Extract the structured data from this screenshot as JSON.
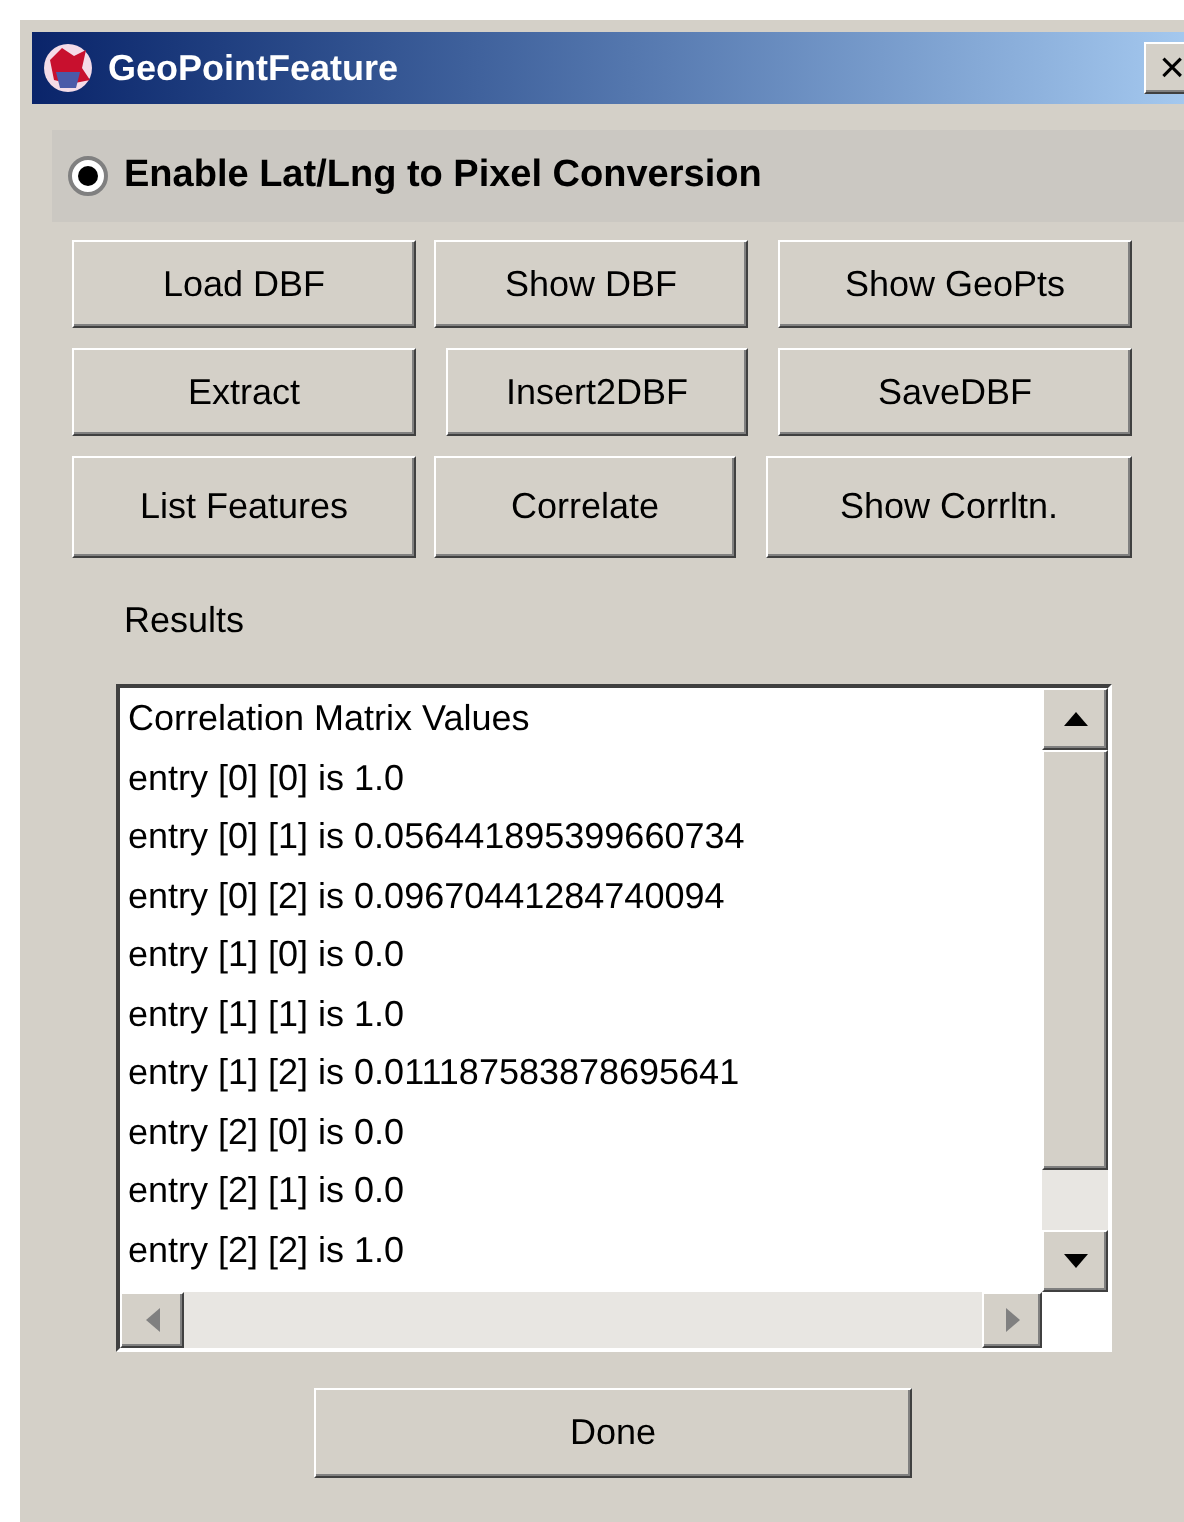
{
  "window": {
    "title": "GeoPointFeature",
    "close": "×"
  },
  "option": {
    "label": "Enable Lat/Lng to Pixel Conversion",
    "selected": true
  },
  "button_rows": [
    [
      "Load DBF",
      "Show DBF",
      "Show GeoPts"
    ],
    [
      "Extract",
      "Insert2DBF",
      "SaveDBF"
    ],
    [
      "List Features",
      "Correlate",
      "Show Corrltn."
    ]
  ],
  "results_label": "Results",
  "results_lines": [
    "Correlation Matrix Values",
    "entry [0] [0] is 1.0",
    "entry [0] [1] is 0.056441895399660734",
    "entry [0] [2] is 0.09670441284740094",
    "entry [1] [0] is 0.0",
    "entry [1] [1] is 1.0",
    "entry [1] [2] is 0.011187583878695641",
    "entry [2] [0] is 0.0",
    "entry [2] [1] is 0.0",
    "entry [2] [2] is 1.0"
  ],
  "done_button": "Done"
}
